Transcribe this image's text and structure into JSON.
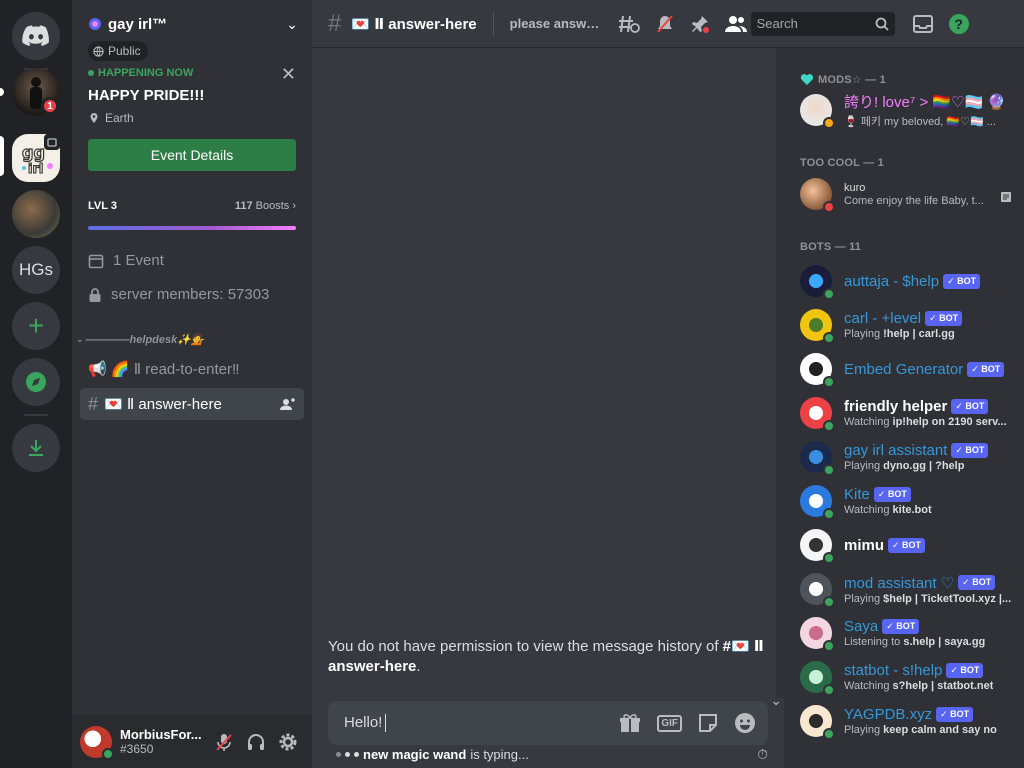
{
  "server": {
    "name": "gay irl™",
    "visibility": "Public",
    "event": {
      "status": "HAPPENING NOW",
      "title": "HAPPY PRIDE!!!",
      "location": "Earth",
      "button_label": "Event Details"
    },
    "boost": {
      "level": "LVL 3",
      "count": "117",
      "label": "Boosts",
      "progress": 1.0
    },
    "events_label": "1 Event",
    "members_label": "server members: 57303"
  },
  "rail": {
    "badge_count": "1",
    "hg_label": "HGs"
  },
  "channels": {
    "category": "————helpdesk✨💁",
    "items": [
      {
        "name": "📢 🌈 Ⅱ read-to-enter‼",
        "active": false
      },
      {
        "name": "💌 Ⅱ answer-here",
        "active": true
      }
    ]
  },
  "user": {
    "name": "MorbiusFor...",
    "tag": "#3650"
  },
  "topbar": {
    "channel": "💌 Ⅱ answer-here",
    "topic": "please answer...",
    "search_placeholder": "Search"
  },
  "chat": {
    "no_permission_prefix": "You do not have permission to view the message history of ",
    "no_permission_channel": "#💌 Ⅱ answer-here",
    "no_permission_suffix": ".",
    "composer_value": "Hello!",
    "typing_user": "new magic wand",
    "typing_suffix": "is typing..."
  },
  "members": {
    "groups": [
      {
        "header": "MODS☆ — 1",
        "items": [
          {
            "name": "誇り! love⁷ > 🏳️‍🌈♡🏳️‍⚧️ 🔮",
            "activity": "🍷 페키 my beloved, 🏳️‍🌈♡🏳️‍⚧️ ...",
            "bot": false,
            "color": "#f47fff",
            "status": "idle"
          }
        ]
      },
      {
        "header": "TOO COOL — 1",
        "items": [
          {
            "name": "kuro",
            "activity": "Come enjoy the life Baby, t...",
            "bot": false,
            "color": "#dcddde",
            "status": "dnd"
          }
        ]
      },
      {
        "header": "BOTS — 11",
        "items": [
          {
            "name": "auttaja - $help",
            "activity": "",
            "bot": true,
            "color": "#3498db",
            "status": "online"
          },
          {
            "name": "carl - +level",
            "activity_label": "Playing",
            "activity": "!help | carl.gg",
            "bot": true,
            "color": "#3498db",
            "status": "online"
          },
          {
            "name": "Embed Generator",
            "activity": "",
            "bot": true,
            "color": "#3498db",
            "status": "online"
          },
          {
            "name": "friendly helper",
            "activity_label": "Watching",
            "activity": "ip!help on 2190 serv...",
            "bot": true,
            "color": "#ffffff",
            "status": "online"
          },
          {
            "name": "gay irl assistant",
            "activity_label": "Playing",
            "activity": "dyno.gg | ?help",
            "bot": true,
            "color": "#3498db",
            "status": "online"
          },
          {
            "name": "Kite",
            "activity_label": "Watching",
            "activity": "kite.bot",
            "bot": true,
            "color": "#3498db",
            "status": "online"
          },
          {
            "name": "mimu",
            "activity": "",
            "bot": true,
            "color": "#ffffff",
            "status": "online"
          },
          {
            "name": "mod assistant ♡",
            "activity_label": "Playing",
            "activity": "$help | TicketTool.xyz |...",
            "bot": true,
            "color": "#3498db",
            "status": "online"
          },
          {
            "name": "Saya",
            "activity_label": "Listening to",
            "activity": "s.help | saya.gg",
            "bot": true,
            "color": "#3498db",
            "status": "online"
          },
          {
            "name": "statbot - s!help",
            "activity_label": "Watching",
            "activity": "s?help | statbot.net",
            "bot": true,
            "color": "#3498db",
            "status": "online"
          },
          {
            "name": "YAGPDB.xyz",
            "activity_label": "Playing",
            "activity": "keep calm and say no",
            "bot": true,
            "color": "#3498db",
            "status": "online"
          }
        ]
      }
    ],
    "bot_label": "BOT"
  }
}
